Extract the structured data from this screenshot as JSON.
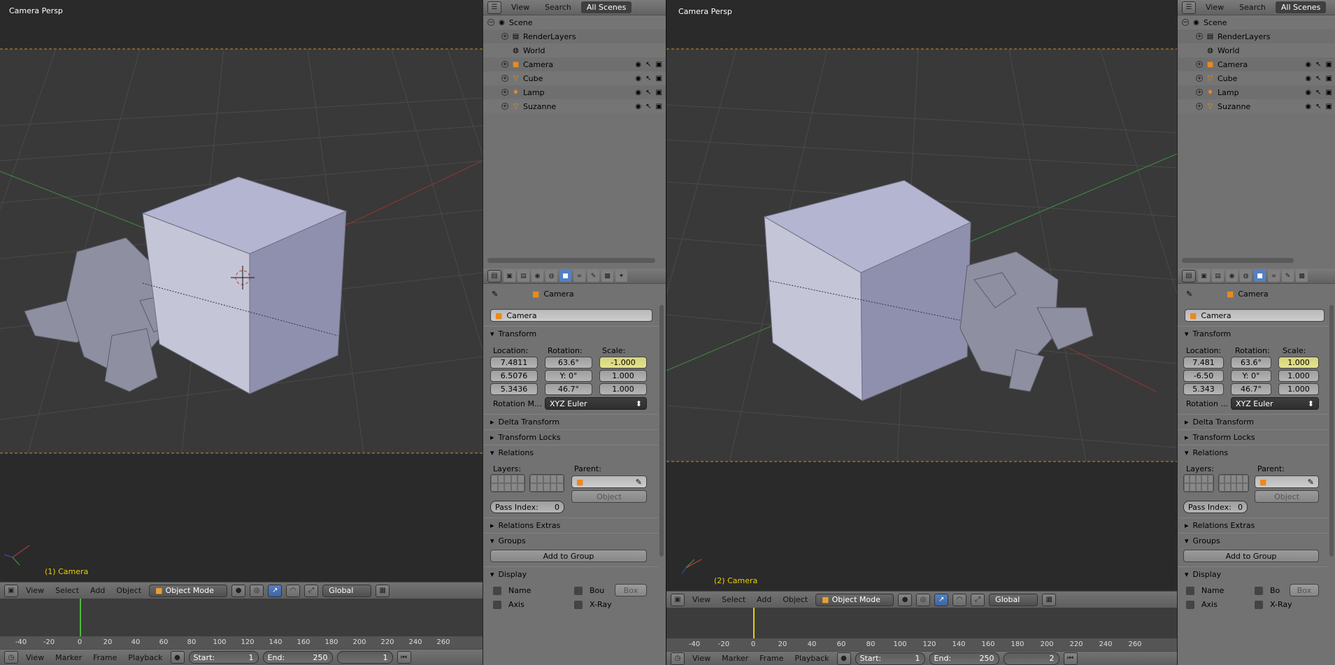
{
  "viewport_left": {
    "title": "Camera Persp",
    "active_label": "(1) Camera"
  },
  "viewport_right": {
    "title": "Camera Persp",
    "active_label": "(2) Camera"
  },
  "view_header": {
    "view": "View",
    "select": "Select",
    "add": "Add",
    "object": "Object",
    "mode": "Object Mode",
    "orientation": "Global"
  },
  "timeline_ticks": [
    "-40",
    "-20",
    "0",
    "20",
    "40",
    "60",
    "80",
    "100",
    "120",
    "140",
    "160",
    "180",
    "200",
    "220",
    "240",
    "260"
  ],
  "timeline_header": {
    "view": "View",
    "marker": "Marker",
    "frame": "Frame",
    "playback": "Playback",
    "start_label": "Start:",
    "start_value": "1",
    "end_label": "End:",
    "end_value": "250",
    "current_left": "1",
    "current_right": "2"
  },
  "outliner": {
    "tabs": [
      "View",
      "Search",
      "All Scenes"
    ],
    "rows": [
      {
        "label": "Scene",
        "icon": "scene-icon"
      },
      {
        "label": "RenderLayers",
        "icon": "renderlayers-icon"
      },
      {
        "label": "World",
        "icon": "world-icon"
      },
      {
        "label": "Camera",
        "icon": "camera-object-icon"
      },
      {
        "label": "Cube",
        "icon": "mesh-icon"
      },
      {
        "label": "Lamp",
        "icon": "lamp-icon"
      },
      {
        "label": "Suzanne",
        "icon": "mesh-icon"
      }
    ]
  },
  "props_left": {
    "breadcrumb": "Camera",
    "object_name": "Camera",
    "transform": "Transform",
    "location_label": "Location:",
    "rotation_label": "Rotation:",
    "scale_label": "Scale:",
    "location": [
      "7.4811",
      "6.5076",
      "5.3436"
    ],
    "rotation": [
      "63.6°",
      "0°",
      "46.7°"
    ],
    "rotation_prefix": [
      "",
      "Y:",
      ""
    ],
    "scale": [
      "-1.000",
      "1.000",
      "1.000"
    ],
    "rotation_mode_label": "Rotation M...",
    "rotation_mode": "XYZ Euler",
    "delta": "Delta Transform",
    "locks": "Transform Locks",
    "relations": "Relations",
    "layers_label": "Layers:",
    "parent_label": "Parent:",
    "parent_type": "Object",
    "pass_index_label": "Pass Index:",
    "pass_index": "0",
    "relations_extras": "Relations Extras",
    "groups": "Groups",
    "add_to_group": "Add to Group",
    "display": "Display",
    "name": "Name",
    "bounds": "Bou",
    "box": "Box",
    "axis": "Axis",
    "xray": "X-Ray"
  },
  "props_right": {
    "breadcrumb": "Camera",
    "object_name": "Camera",
    "transform": "Transform",
    "location_label": "Location:",
    "rotation_label": "Rotation:",
    "scale_label": "Scale:",
    "location": [
      "7.481",
      "-6.50",
      "5.343"
    ],
    "rotation": [
      "63.6°",
      "0°",
      "46.7°"
    ],
    "rotation_prefix": [
      "",
      "Y:",
      ""
    ],
    "scale": [
      "1.000",
      "1.000",
      "1.000"
    ],
    "rotation_mode_label": "Rotation ...",
    "rotation_mode": "XYZ Euler",
    "delta": "Delta Transform",
    "locks": "Transform Locks",
    "relations": "Relations",
    "layers_label": "Layers:",
    "parent_label": "Parent:",
    "parent_type": "Object",
    "pass_index_label": "Pass Index:",
    "pass_index": "0",
    "relations_extras": "Relations Extras",
    "groups": "Groups",
    "add_to_group": "Add to Group",
    "display": "Display",
    "name": "Name",
    "bounds": "Bo",
    "box": "Box",
    "axis": "Axis",
    "xray": "X-Ray"
  },
  "colors": {
    "viewport_bg": "#393939",
    "selection": "#e8d000",
    "cube_top": "#b3b4cf",
    "cube_side": "#8f90ad",
    "header": "#6a6a6a"
  }
}
